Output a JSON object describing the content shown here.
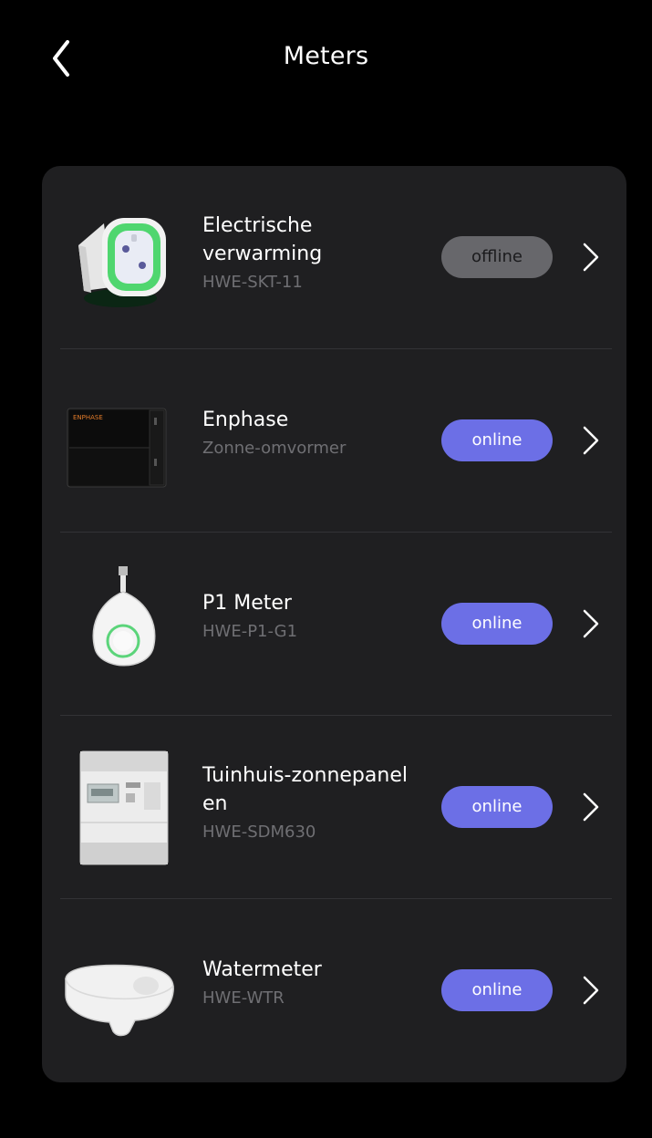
{
  "header": {
    "title": "Meters",
    "back_icon": "chevron-left-icon"
  },
  "meters": [
    {
      "name_line1": "Electrische",
      "name_line2": "verwarming",
      "model": "HWE-SKT-11",
      "status": "offline",
      "image": "smart-plug-image"
    },
    {
      "name_line1": "Enphase",
      "name_line2": "",
      "model": "Zonne-omvormer",
      "status": "online",
      "image": "enphase-inverter-image",
      "image_label": "ENPHASE"
    },
    {
      "name_line1": "P1 Meter",
      "name_line2": "",
      "model": "HWE-P1-G1",
      "status": "online",
      "image": "p1-meter-image"
    },
    {
      "name_line1": "Tuinhuis-zonnepanel",
      "name_line2": "en",
      "model": "HWE-SDM630",
      "status": "online",
      "image": "kwh-meter-image"
    },
    {
      "name_line1": "Watermeter",
      "name_line2": "",
      "model": "HWE-WTR",
      "status": "online",
      "image": "water-meter-image"
    }
  ],
  "colors": {
    "background": "#000000",
    "card": "#1f1f21",
    "online_badge": "#6c6fe6",
    "offline_badge": "#67676b",
    "subtitle": "#6f6f73"
  }
}
